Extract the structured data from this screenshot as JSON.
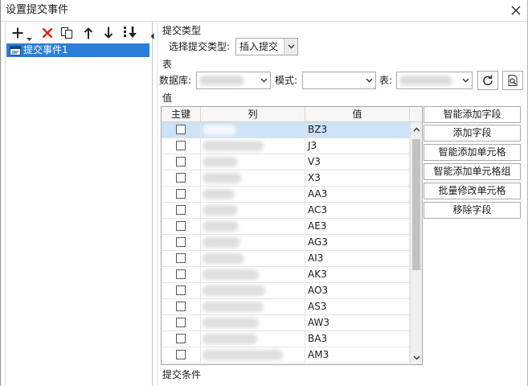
{
  "window": {
    "title": "设置提交事件"
  },
  "toolbar": {
    "icons": [
      "add-icon",
      "add-dropdown-arrow-icon",
      "delete-icon",
      "copy-icon",
      "move-up-icon",
      "move-down-icon",
      "sort-icon"
    ]
  },
  "tree": {
    "items": [
      {
        "label": "提交事件1",
        "icon": "submit-event-icon",
        "selected": true
      }
    ]
  },
  "submit_type": {
    "section_title": "提交类型",
    "label": "选择提交类型:",
    "selected_value": "插入提交"
  },
  "table_source": {
    "section_title": "表",
    "database_label": "数据库:",
    "schema_label": "模式:",
    "table_label": "表:",
    "refresh_icon": "refresh-icon",
    "preview_icon": "preview-icon"
  },
  "values": {
    "section_title": "值",
    "columns": [
      "主键",
      "列",
      "值"
    ],
    "selected_row": 0,
    "rows": [
      {
        "primary_key": false,
        "value": "BZ3"
      },
      {
        "primary_key": false,
        "value": "J3"
      },
      {
        "primary_key": false,
        "value": "V3"
      },
      {
        "primary_key": false,
        "value": "X3"
      },
      {
        "primary_key": false,
        "value": "AA3"
      },
      {
        "primary_key": false,
        "value": "AC3"
      },
      {
        "primary_key": false,
        "value": "AE3"
      },
      {
        "primary_key": false,
        "value": "AG3"
      },
      {
        "primary_key": false,
        "value": "AI3"
      },
      {
        "primary_key": false,
        "value": "AK3"
      },
      {
        "primary_key": false,
        "value": "AO3"
      },
      {
        "primary_key": false,
        "value": "AS3"
      },
      {
        "primary_key": false,
        "value": "AW3"
      },
      {
        "primary_key": false,
        "value": "BA3"
      },
      {
        "primary_key": false,
        "value": "AM3"
      }
    ]
  },
  "actions": [
    {
      "label": "智能添加字段"
    },
    {
      "label": "添加字段"
    },
    {
      "label": "智能添加单元格"
    },
    {
      "label": "智能添加单元格组"
    },
    {
      "label": "批量修改单元格"
    },
    {
      "label": "移除字段"
    }
  ],
  "condition": {
    "section_title": "提交条件"
  },
  "colors": {
    "tree_selection": "#2b7fd8",
    "row_selection": "#cce2f6",
    "delete_icon": "#e02020"
  }
}
